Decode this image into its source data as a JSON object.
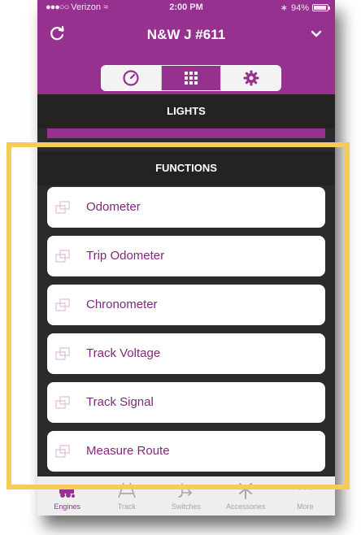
{
  "status_bar": {
    "carrier": "Verizon",
    "time": "2:00 PM",
    "battery": "94%"
  },
  "nav": {
    "title": "N&W J #611",
    "refresh_icon": "refresh-icon",
    "menu_icon": "chevron-down-icon"
  },
  "segments": [
    {
      "icon": "gauge-icon",
      "active": false
    },
    {
      "icon": "grid-icon",
      "active": true
    },
    {
      "icon": "gear-icon",
      "active": false
    }
  ],
  "lights": {
    "label": "LIGHTS"
  },
  "functions": {
    "label": "FUNCTIONS",
    "items": [
      {
        "label": "Odometer"
      },
      {
        "label": "Trip Odometer"
      },
      {
        "label": "Chronometer"
      },
      {
        "label": "Track Voltage"
      },
      {
        "label": "Track Signal"
      },
      {
        "label": "Measure Route"
      }
    ]
  },
  "tabbar": {
    "tabs": [
      {
        "label": "Engines",
        "active": true
      },
      {
        "label": "Track",
        "active": false
      },
      {
        "label": "Switches",
        "active": false
      },
      {
        "label": "Accessories",
        "active": false
      },
      {
        "label": "More",
        "active": false
      }
    ]
  },
  "colors": {
    "accent": "#96318f",
    "highlight": "#f4cd57",
    "dark": "#232323"
  }
}
